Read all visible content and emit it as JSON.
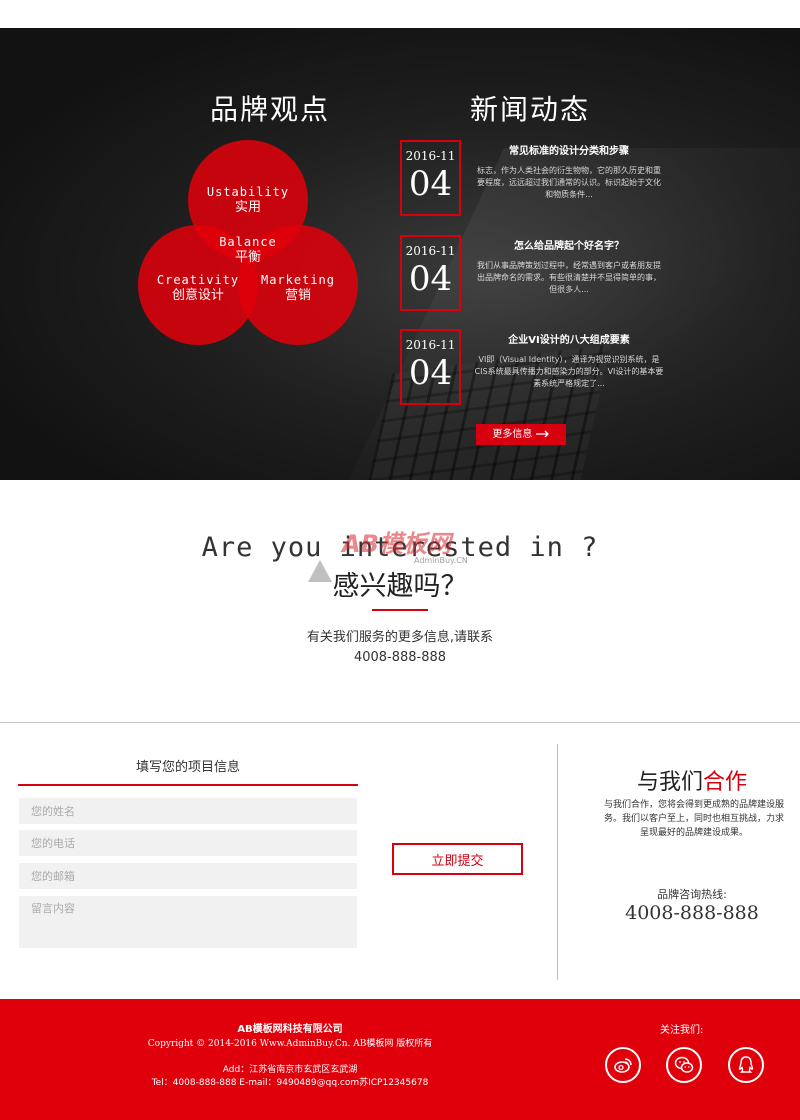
{
  "brand": {
    "title": "品牌观点",
    "circles": [
      {
        "en": "Ustability",
        "cn": "实用"
      },
      {
        "en": "Balance",
        "cn": "平衡"
      },
      {
        "en": "Creativity",
        "cn": "创意设计"
      },
      {
        "en": "Marketing",
        "cn": "营销"
      }
    ]
  },
  "news": {
    "title": "新闻动态",
    "items": [
      {
        "year_month": "2016-11",
        "day": "04",
        "title": "常见标准的设计分类和步骤",
        "desc": "标志，作为人类社会的衍生物物，它的那久历史和重要程度，远远超过我们通常的认识。标识起始于文化和物质条件..."
      },
      {
        "year_month": "2016-11",
        "day": "04",
        "title": "怎么给品牌起个好名字？",
        "desc": "我们从事品牌策划过程中，经常遇到客户或者朋友提出品牌命名的需求。有些很清楚并不显得简单的事，但很多人..."
      },
      {
        "year_month": "2016-11",
        "day": "04",
        "title": "企业VI设计的八大组成要素",
        "desc": "VI即（Visual Identity），通译为视觉识别系统，是CIS系统最具传播力和感染力的部分。VI设计的基本要素系统严格规定了..."
      }
    ],
    "more_label": "更多信息"
  },
  "interest": {
    "en": "Are you interested in ?",
    "cn": "感兴趣吗？",
    "line1": "有关我们服务的更多信息,请联系",
    "line2": "4008-888-888",
    "watermark": "AB模板网",
    "watermark_sub": "AdminBuy.CN"
  },
  "form": {
    "title": "填写您的项目信息",
    "name_placeholder": "您的姓名",
    "phone_placeholder": "您的电话",
    "email_placeholder": "您的邮箱",
    "message_placeholder": "留言内容",
    "submit_label": "立即提交"
  },
  "cooperate": {
    "title_black": "与我们",
    "title_red": "合作",
    "desc": "与我们合作，您将会得到更成熟的品牌建设服务。我们以客户至上，同时也相互挑战，力求呈现最好的品牌建设成果。",
    "hotline_label": "品牌咨询热线:",
    "hotline": "4008-888-888"
  },
  "footer": {
    "company": "AB模板网科技有限公司",
    "copyright": "Copyright © 2014-2016 Www.AdminBuy.Cn. AB模板网 版权所有",
    "address": "Add：江苏省南京市玄武区玄武湖",
    "contact": "Tel：4008-888-888   E-mail：9490489@qq.com苏ICP12345678",
    "follow_label": "关注我们:",
    "social_icons": [
      "weibo-icon",
      "wechat-icon",
      "qq-icon"
    ]
  },
  "colors": {
    "accent": "#d6000f",
    "footer_bg": "#e0000c",
    "dark_bg": "#151515"
  }
}
